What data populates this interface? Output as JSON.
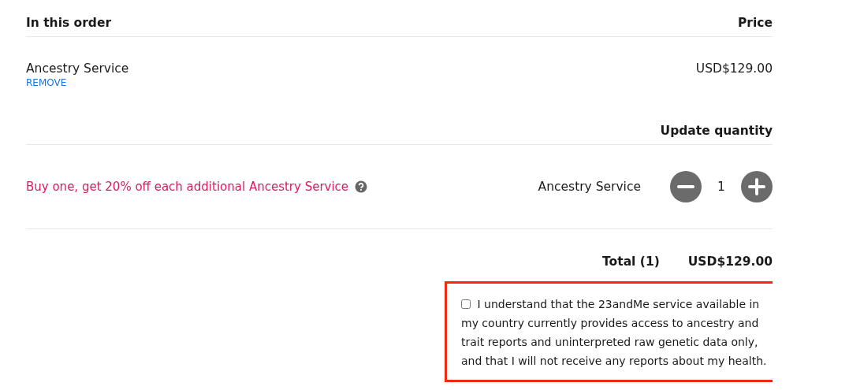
{
  "order_header": {
    "title": "In this order",
    "price_label": "Price"
  },
  "items": [
    {
      "name": "Ancestry Service",
      "remove_link": "REMOVE",
      "price": "USD$129.00"
    }
  ],
  "quantity_section": {
    "title": "Update quantity",
    "promo": "Buy one, get 20% off each additional Ancestry Service",
    "product": "Ancestry Service",
    "quantity": "1"
  },
  "total": {
    "label": "Total (1)",
    "amount": "USD$129.00"
  },
  "agreement": {
    "checked": false,
    "highlighted": true,
    "text": "I understand that the 23andMe service available in my country currently provides access to ancestry and trait reports and uninterpreted raw genetic data only, and that I will not receive any reports about my health."
  }
}
